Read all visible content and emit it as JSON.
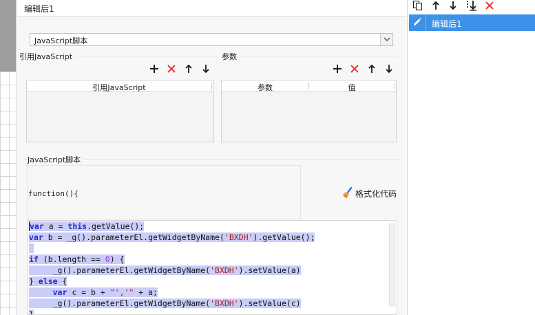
{
  "dialog": {
    "title": "编辑后1"
  },
  "type_select": {
    "value": "JavaScript脚本"
  },
  "references": {
    "label": "引用JavaScript",
    "column": "引用JavaScript"
  },
  "params": {
    "label": "参数",
    "columns": [
      "参数",
      "值"
    ]
  },
  "script": {
    "label": "JavaScript脚本",
    "function_header": "function(){",
    "format_button": "格式化代码"
  },
  "code_lines": [
    [
      {
        "t": "var",
        "c": "kw"
      },
      {
        "t": " a = ",
        "c": "id"
      },
      {
        "t": "this",
        "c": "kw"
      },
      {
        "t": ".getValue();",
        "c": "id"
      }
    ],
    [
      {
        "t": "var",
        "c": "kw"
      },
      {
        "t": " b = _g().parameterEl.getWidgetByName(",
        "c": "id"
      },
      {
        "t": "'BXDH'",
        "c": "str"
      },
      {
        "t": ").getValue();",
        "c": "id"
      }
    ],
    [],
    [
      {
        "t": "if",
        "c": "kw"
      },
      {
        "t": " (b.length == ",
        "c": "id"
      },
      {
        "t": "0",
        "c": "num"
      },
      {
        "t": ") {",
        "c": "id"
      }
    ],
    [
      {
        "t": "     _g().parameterEl.getWidgetByName(",
        "c": "id"
      },
      {
        "t": "'BXDH'",
        "c": "str"
      },
      {
        "t": ").setValue(a)",
        "c": "id"
      }
    ],
    [
      {
        "t": "} ",
        "c": "id"
      },
      {
        "t": "else",
        "c": "kw"
      },
      {
        "t": " {",
        "c": "id"
      }
    ],
    [
      {
        "t": "     ",
        "c": "id"
      },
      {
        "t": "var",
        "c": "kw"
      },
      {
        "t": " c = b + ",
        "c": "id"
      },
      {
        "t": "\"','\"",
        "c": "str"
      },
      {
        "t": " + a;",
        "c": "id"
      }
    ],
    [
      {
        "t": "     _g().parameterEl.getWidgetByName(",
        "c": "id"
      },
      {
        "t": "'BXDH'",
        "c": "str"
      },
      {
        "t": ").setValue(c)",
        "c": "id"
      }
    ],
    [
      {
        "t": "}",
        "c": "id"
      }
    ]
  ],
  "right_panel": {
    "items": [
      {
        "label": "编辑后1"
      }
    ]
  },
  "colors": {
    "accent": "#3d92e8",
    "add": "#1a1a1a",
    "delete": "#e53935",
    "keyword": "#2229c7",
    "string": "#b01818",
    "selection": "#c9cdf8"
  },
  "icons": {
    "add": "plus-icon",
    "delete": "close-icon",
    "up": "arrow-up-icon",
    "down": "arrow-down-icon",
    "copy": "copy-icon",
    "move_bottom": "move-bottom-icon",
    "edit": "pencil-icon",
    "format": "broom-icon"
  }
}
